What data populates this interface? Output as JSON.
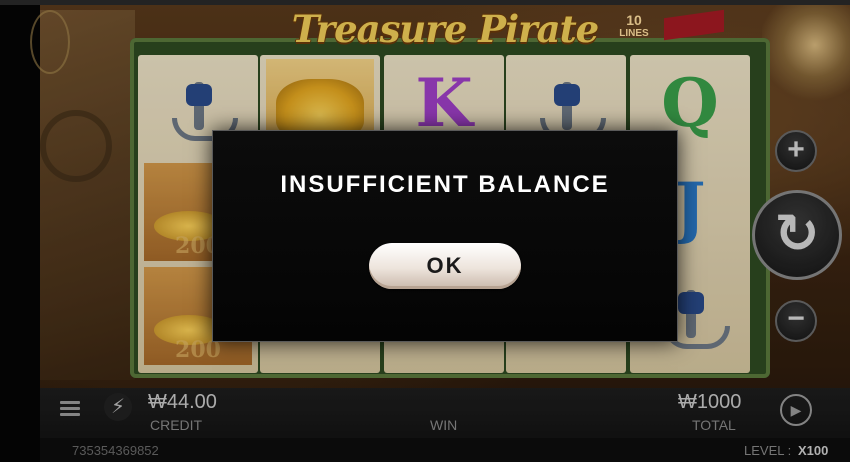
{
  "game": {
    "title": "Treasure Pirate",
    "lines_count": "10",
    "lines_label": "LINES"
  },
  "reels": [
    {
      "symbols": [
        "anchor",
        "gold-chest",
        "gold-chest"
      ],
      "chest_values": [
        "",
        "200",
        "200"
      ]
    },
    {
      "symbols": [
        "gold-coins",
        "",
        ""
      ],
      "chest_values": [
        "",
        "",
        ""
      ]
    },
    {
      "symbols": [
        "K",
        "",
        ""
      ],
      "chest_values": [
        "",
        "",
        ""
      ]
    },
    {
      "symbols": [
        "anchor",
        "",
        ""
      ],
      "chest_values": [
        "",
        "",
        ""
      ]
    },
    {
      "symbols": [
        "Q",
        "J",
        "anchor"
      ],
      "chest_values": [
        "",
        "",
        ""
      ]
    }
  ],
  "letters": {
    "k": "K",
    "q": "Q",
    "j": "J"
  },
  "chest_value": "200",
  "controls": {
    "plus": "+",
    "minus": "−",
    "spin": "↻",
    "bolt": "⚡",
    "auto": "▶"
  },
  "bottom_bar": {
    "credit_value": "₩44.00",
    "credit_label": "CREDIT",
    "win_label": "WIN",
    "total_value": "₩1000",
    "total_label": "TOTAL",
    "session_id": "735354369852",
    "level_label": "LEVEL :",
    "level_value": "X100"
  },
  "dialog": {
    "message": "INSUFFICIENT BALANCE",
    "ok_label": "OK"
  },
  "colors": {
    "title_gold": "#f2cf5a",
    "reel_frame_green": "#2e4a22",
    "letter_k": "#a040c8",
    "letter_q": "#3aa04a",
    "letter_j": "#2a7ac8",
    "dialog_bg": "#050505",
    "ok_button": "#ede4dc"
  }
}
